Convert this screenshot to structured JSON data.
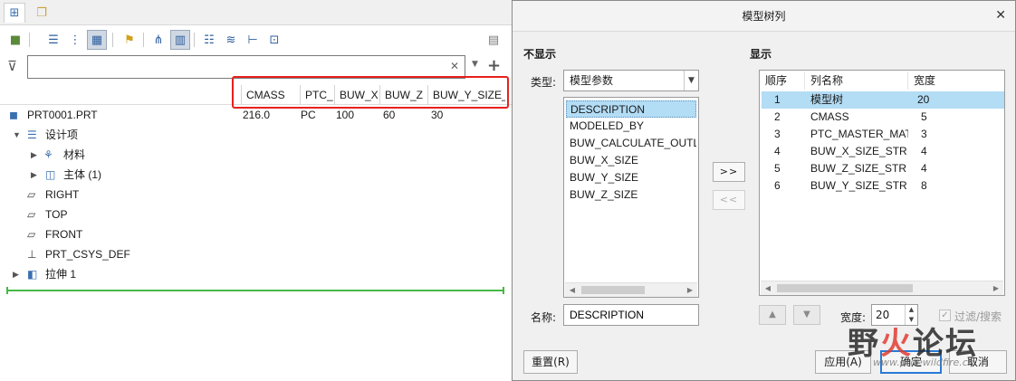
{
  "tree_panel": {
    "filter_placeholder": "",
    "columns": [
      "CMASS",
      "PTC_",
      "BUW_X",
      "BUW_Z",
      "BUW_Y_SIZE_S"
    ],
    "rows": [
      {
        "label": "PRT0001.PRT",
        "icon": "part-icon",
        "values": [
          "216.0",
          "PC",
          "100",
          "60",
          "30"
        ]
      },
      {
        "label": "设计项",
        "icon": "design-items-icon",
        "values": []
      },
      {
        "label": "材料",
        "icon": "material-icon",
        "values": []
      },
      {
        "label": "主体 (1)",
        "icon": "body-icon",
        "values": []
      },
      {
        "label": "RIGHT",
        "icon": "datum-plane-icon",
        "values": []
      },
      {
        "label": "TOP",
        "icon": "datum-plane-icon",
        "values": []
      },
      {
        "label": "FRONT",
        "icon": "datum-plane-icon",
        "values": []
      },
      {
        "label": "PRT_CSYS_DEF",
        "icon": "csys-icon",
        "values": []
      },
      {
        "label": "拉伸 1",
        "icon": "extrude-icon",
        "values": []
      }
    ]
  },
  "dialog": {
    "title": "模型树列",
    "not_shown_label": "不显示",
    "shown_label": "显示",
    "type_label": "类型:",
    "type_value": "模型参数",
    "param_list": [
      "DESCRIPTION",
      "MODELED_BY",
      "BUW_CALCULATE_OUTL",
      "BUW_X_SIZE",
      "BUW_Y_SIZE",
      "BUW_Z_SIZE"
    ],
    "add_button": ">>",
    "remove_button": "<<",
    "name_label": "名称:",
    "name_value": "DESCRIPTION",
    "table_headers": [
      "顺序",
      "列名称",
      "宽度"
    ],
    "table_rows": [
      {
        "order": "1",
        "name": "模型树",
        "width": "20"
      },
      {
        "order": "2",
        "name": "CMASS",
        "width": "5"
      },
      {
        "order": "3",
        "name": "PTC_MASTER_MAT",
        "width": "3"
      },
      {
        "order": "4",
        "name": "BUW_X_SIZE_STR",
        "width": "4"
      },
      {
        "order": "5",
        "name": "BUW_Z_SIZE_STR",
        "width": "4"
      },
      {
        "order": "6",
        "name": "BUW_Y_SIZE_STR",
        "width": "8"
      }
    ],
    "width_label": "宽度:",
    "width_value": "20",
    "filter_search_label": "过滤/搜索",
    "reset_button": "重置(R)",
    "apply_button": "应用(A)",
    "ok_button": "确定",
    "cancel_button": "取消"
  },
  "watermark": {
    "text_black": "野",
    "text_red": "火",
    "text_black2": "论坛",
    "url": "www.proewildfire.cn"
  }
}
